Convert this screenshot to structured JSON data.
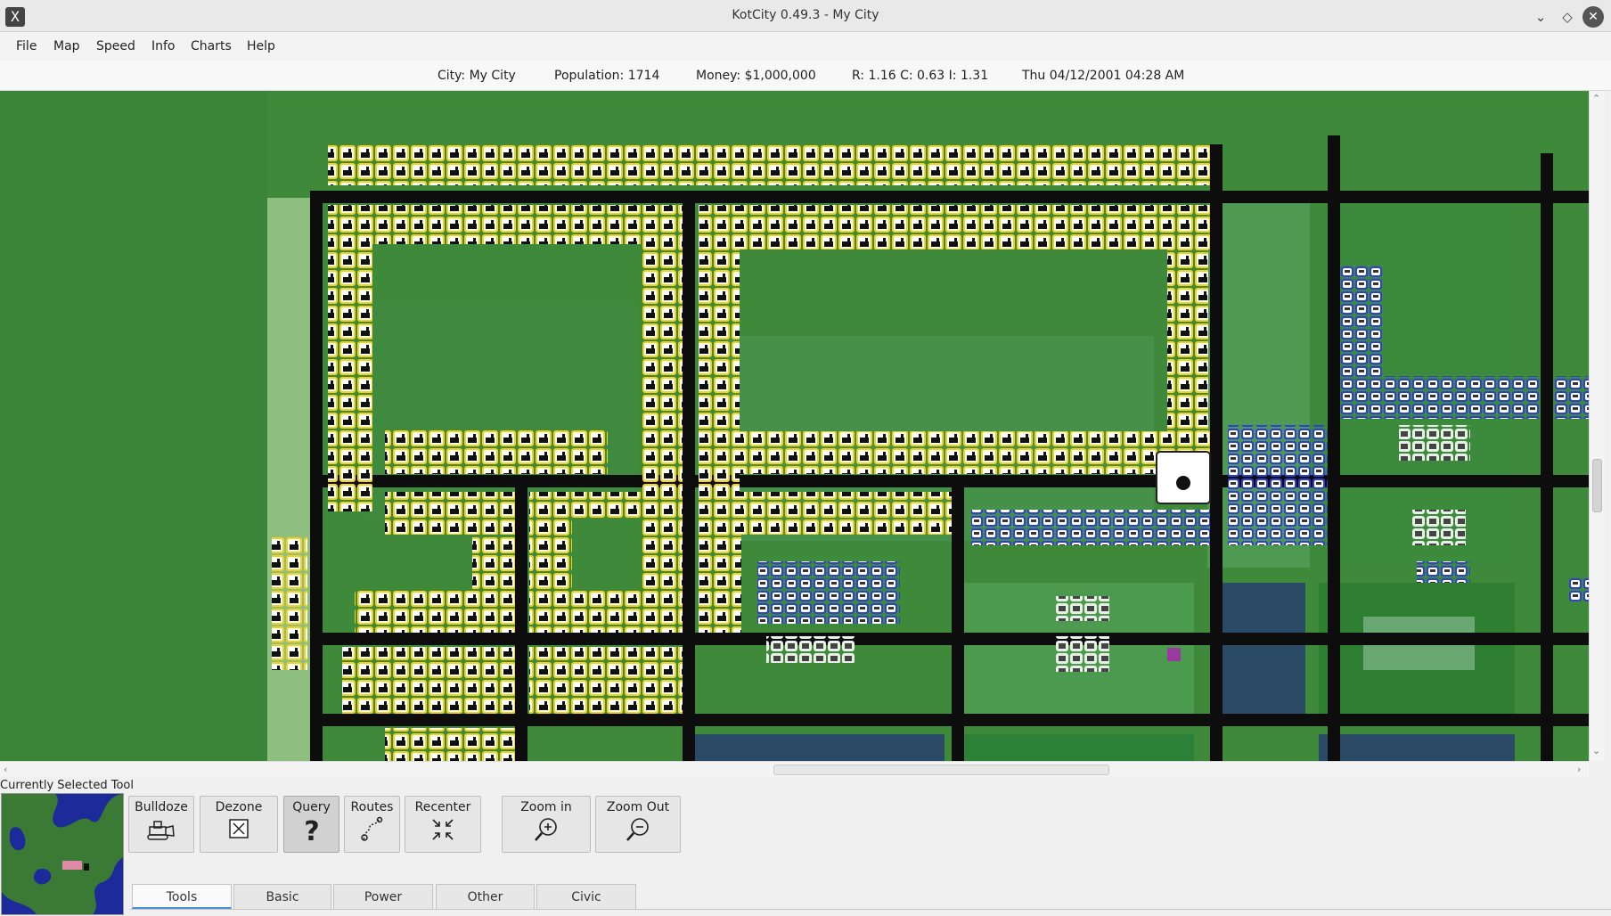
{
  "window": {
    "title": "KotCity 0.49.3 - My City"
  },
  "menu": [
    "File",
    "Map",
    "Speed",
    "Info",
    "Charts",
    "Help"
  ],
  "status": {
    "city": "City: My City",
    "population": "Population: 1714",
    "money": "Money: $1,000,000",
    "demand": "R: 1.16 C: 0.63 I: 1.31",
    "datetime": "Thu 04/12/2001 04:28 AM"
  },
  "toolbar": {
    "selected_label": "Currently Selected Tool",
    "tools": [
      {
        "label": "Bulldoze",
        "icon": "bulldozer-icon"
      },
      {
        "label": "Dezone",
        "icon": "dezone-icon"
      },
      {
        "label": "Query",
        "icon": "question-icon"
      },
      {
        "label": "Routes",
        "icon": "routes-icon"
      },
      {
        "label": "Recenter",
        "icon": "recenter-icon"
      },
      {
        "label": "Zoom in",
        "icon": "zoom-in-icon"
      },
      {
        "label": "Zoom Out",
        "icon": "zoom-out-icon"
      }
    ],
    "active_tool": "Query"
  },
  "tabs": [
    "Tools",
    "Basic",
    "Power",
    "Other",
    "Civic"
  ],
  "active_tab": "Tools",
  "colors": {
    "grass": "#3e8a3a",
    "road": "#0d0d0d",
    "industrial_zone": "#f2d21a",
    "commercial_zone": "#2f3fd0",
    "water_lot": "#2b4a66",
    "minimap_water": "#1c2a9a",
    "minimap_land": "#3a7a34"
  }
}
